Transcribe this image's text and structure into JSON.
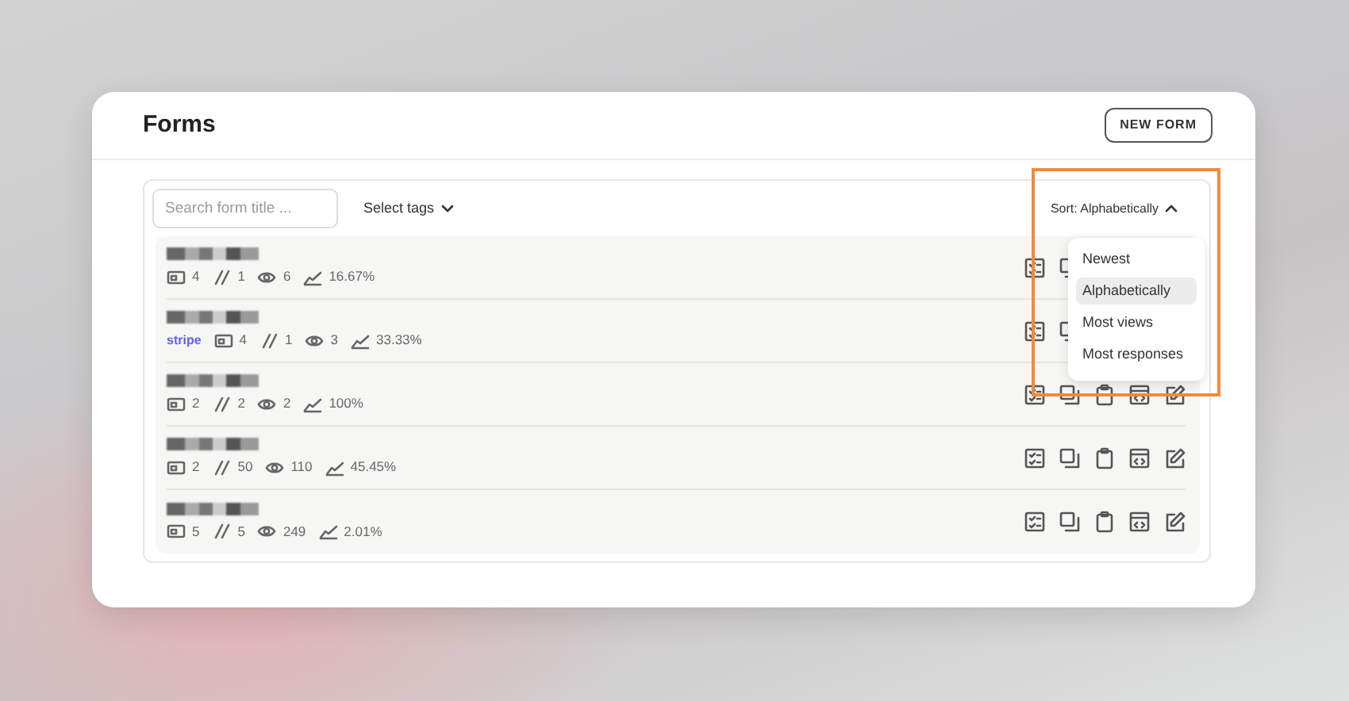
{
  "header": {
    "title": "Forms",
    "new_button": "NEW FORM"
  },
  "toolbar": {
    "search": {
      "placeholder": "Search form title ..."
    },
    "tags_label": "Select tags",
    "sort": {
      "label": "Sort: Alphabetically",
      "expanded": true,
      "options": [
        {
          "label": "Newest",
          "selected": false
        },
        {
          "label": "Alphabetically",
          "selected": true
        },
        {
          "label": "Most views",
          "selected": false
        },
        {
          "label": "Most responses",
          "selected": false
        }
      ]
    }
  },
  "forms": [
    {
      "fields": "4",
      "responses": "1",
      "views": "6",
      "conversion": "16.67%"
    },
    {
      "tag": "stripe",
      "fields": "4",
      "responses": "1",
      "views": "3",
      "conversion": "33.33%"
    },
    {
      "fields": "2",
      "responses": "2",
      "views": "2",
      "conversion": "100%"
    },
    {
      "fields": "2",
      "responses": "50",
      "views": "110",
      "conversion": "45.45%"
    },
    {
      "fields": "5",
      "responses": "5",
      "views": "249",
      "conversion": "2.01%"
    }
  ]
}
